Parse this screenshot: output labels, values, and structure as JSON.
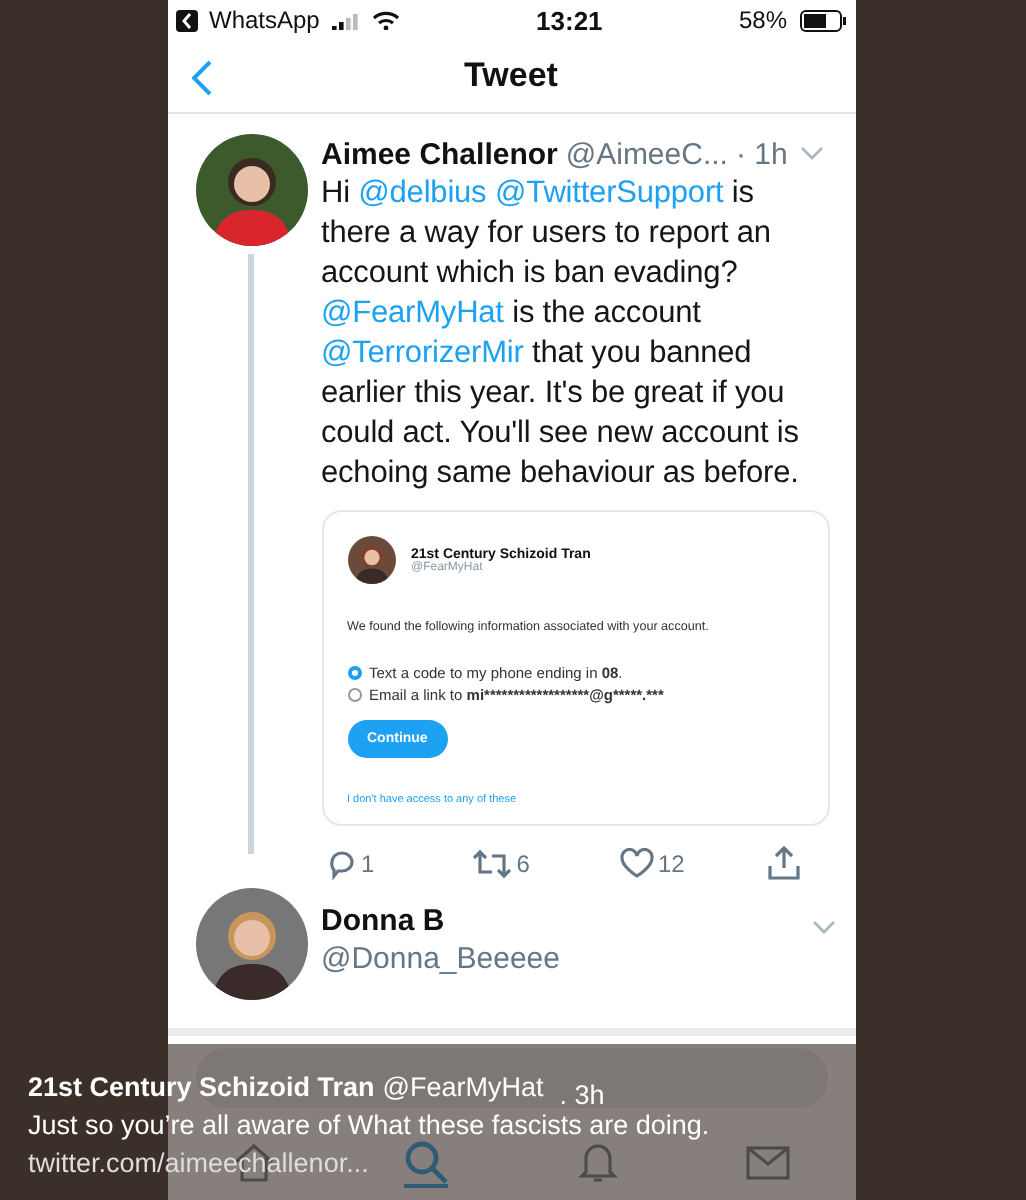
{
  "status_bar": {
    "back_app": "WhatsApp",
    "time": "13:21",
    "battery": "58%"
  },
  "nav": {
    "title": "Tweet"
  },
  "tweet": {
    "name": "Aimee Challenor",
    "handle": "@AimeeC...",
    "time": "· 1h",
    "lines": [
      [
        {
          "kind": "plain",
          "text": "Hi "
        },
        {
          "kind": "mention",
          "text": "@delbius"
        },
        {
          "kind": "mention",
          "text": "@TwitterSupport"
        },
        {
          "kind": "plain",
          "text": " is"
        }
      ],
      [
        {
          "kind": "plain",
          "text": "there a way for users to report an"
        }
      ],
      [
        {
          "kind": "plain",
          "text": "account which is ban evading?"
        }
      ],
      [
        {
          "kind": "mention",
          "text": "@FearMyHat"
        },
        {
          "kind": "plain",
          "text": " is the account"
        }
      ],
      [
        {
          "kind": "mention",
          "text": "@TerrorizerMir"
        },
        {
          "kind": "plain",
          "text": " that you banned"
        }
      ],
      [
        {
          "kind": "plain",
          "text": "earlier this year. It's be great if you"
        }
      ],
      [
        {
          "kind": "plain",
          "text": "could act. You'll see new account is"
        }
      ],
      [
        {
          "kind": "plain",
          "text": "echoing same behaviour as before."
        }
      ]
    ],
    "card": {
      "name": "21st Century Schizoid Tran",
      "handle": "@FearMyHat",
      "message": "We found the following information associated with your account.",
      "options": [
        {
          "text": "Text a code to my phone ending in ",
          "bold": "08",
          "after": ".",
          "selected": true
        },
        {
          "text": "Email a link to ",
          "bold": "mi******************@g*****.***",
          "selected": false
        }
      ],
      "button": "Continue",
      "link": "I don't have access to any of these"
    },
    "actions": [
      {
        "kind": "reply",
        "count": "1"
      },
      {
        "kind": "retweet",
        "count": "6"
      },
      {
        "kind": "like",
        "count": "12"
      },
      {
        "kind": "share"
      }
    ]
  },
  "reply": {
    "name": "Donna B",
    "handle": "@Donna_Beeeee"
  },
  "tabs": [
    {
      "kind": "home",
      "selected": false
    },
    {
      "kind": "search",
      "selected": true
    },
    {
      "kind": "notifications",
      "selected": false
    },
    {
      "kind": "messages",
      "selected": false
    }
  ],
  "caption": {
    "name": "21st Century Schizoid Tran",
    "handle": "@FearMyHat",
    "time": ". 3h",
    "text": "Just so you’re all aware of What these fascists are doing.",
    "link": "twitter.com/aimeechallenor..."
  }
}
